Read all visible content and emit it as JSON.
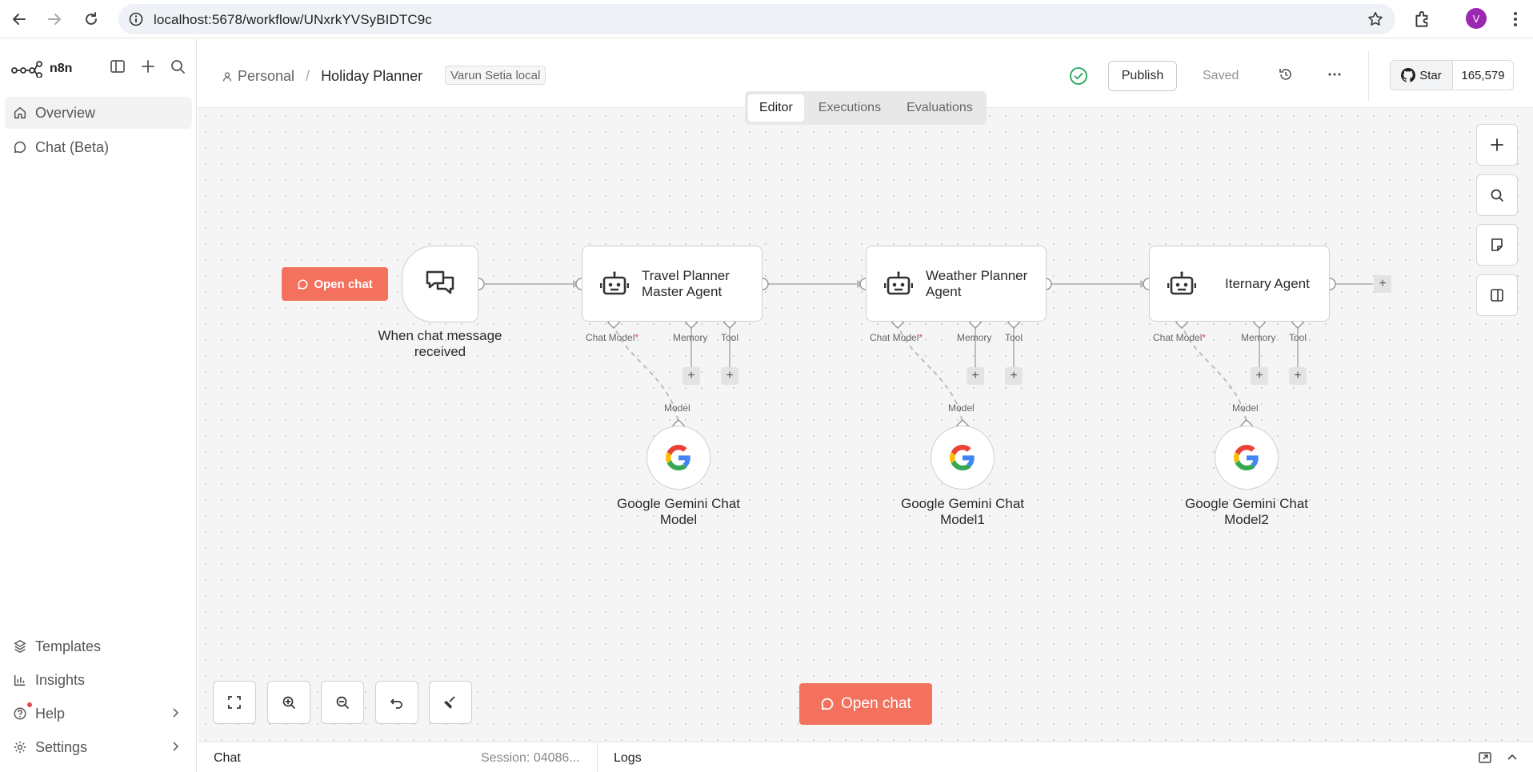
{
  "browser": {
    "url": "localhost:5678/workflow/UNxrkYVSyBIDTC9c",
    "avatar_letter": "V"
  },
  "sidebar": {
    "brand": "n8n",
    "items": [
      {
        "label": "Overview",
        "icon": "home-icon"
      },
      {
        "label": "Chat (Beta)",
        "icon": "chat-bubble-icon"
      }
    ],
    "bottom_items": [
      {
        "label": "Templates",
        "icon": "templates-icon"
      },
      {
        "label": "Insights",
        "icon": "insights-icon"
      },
      {
        "label": "Help",
        "icon": "help-icon"
      },
      {
        "label": "Settings",
        "icon": "gear-icon"
      }
    ]
  },
  "header": {
    "project": "Personal",
    "workflow_name": "Holiday Planner",
    "tag": "Varun Setia local",
    "publish_label": "Publish",
    "saved_label": "Saved",
    "github_star_label": "Star",
    "github_star_count": "165,579"
  },
  "tabs": [
    {
      "label": "Editor",
      "active": true
    },
    {
      "label": "Executions",
      "active": false
    },
    {
      "label": "Evaluations",
      "active": false
    }
  ],
  "workflow": {
    "open_chat_label": "Open chat",
    "trigger": {
      "label": "When chat message received"
    },
    "agents": [
      {
        "title_line1": "Travel Planner",
        "title_line2": "Master Agent"
      },
      {
        "title_line1": "Weather Planner",
        "title_line2": "Agent"
      },
      {
        "title_line1": "Iternary Agent",
        "title_line2": ""
      }
    ],
    "port_labels": {
      "chat_model": "Chat Model",
      "required_mark": "*",
      "memory": "Memory",
      "tool": "Tool",
      "model": "Model"
    },
    "models": [
      {
        "line1": "Google Gemini Chat",
        "line2": "Model"
      },
      {
        "line1": "Google Gemini Chat",
        "line2": "Model1"
      },
      {
        "line1": "Google Gemini Chat",
        "line2": "Model2"
      }
    ]
  },
  "canvas_controls": {
    "open_chat_label": "Open chat"
  },
  "bottom_bar": {
    "chat_label": "Chat",
    "session_label": "Session: 04086...",
    "logs_label": "Logs"
  },
  "colors": {
    "accent": "#f4715d",
    "success": "#23a55a",
    "avatar": "#9c27b0"
  }
}
